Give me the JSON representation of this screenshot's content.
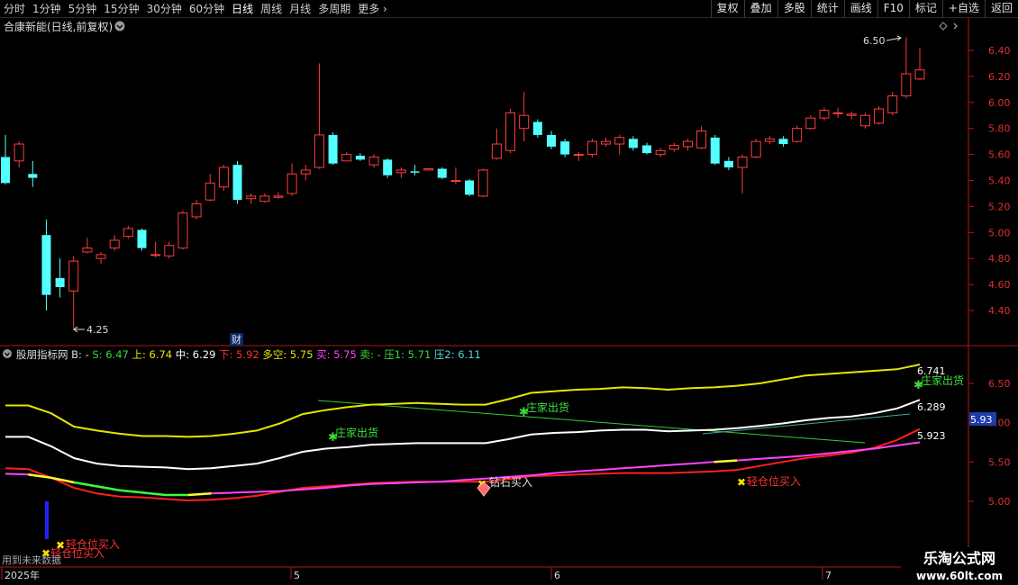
{
  "toolbar": {
    "periods": [
      "分时",
      "1分钟",
      "5分钟",
      "15分钟",
      "30分钟",
      "60分钟",
      "日线",
      "周线",
      "月线",
      "多周期",
      "更多"
    ],
    "active_period": "日线",
    "actions": [
      "复权",
      "叠加",
      "多股",
      "统计",
      "画线",
      "F10",
      "标记",
      "+自选",
      "返回"
    ]
  },
  "main_chart": {
    "title": "合康新能(日线,前复权)",
    "price_ticks": [
      "6.40",
      "6.20",
      "6.00",
      "5.80",
      "5.60",
      "5.40",
      "5.20",
      "5.00",
      "4.80",
      "4.60",
      "4.40"
    ],
    "high_label": "6.50",
    "low_label": "4.25",
    "event_marker": "财"
  },
  "indicator": {
    "name": "股朋指标网",
    "readouts": [
      {
        "label": "B:",
        "value": "-",
        "color": "#dcdcdc"
      },
      {
        "label": "S:",
        "value": "6.47",
        "color": "#39d839"
      },
      {
        "label": "上:",
        "value": "6.74",
        "color": "#e6e600"
      },
      {
        "label": "中:",
        "value": "6.29",
        "color": "#ffffff"
      },
      {
        "label": "下:",
        "value": "5.92",
        "color": "#ff3030"
      },
      {
        "label": "多空:",
        "value": "5.75",
        "color": "#e6e600"
      },
      {
        "label": "买:",
        "value": "5.75",
        "color": "#ff44ff"
      },
      {
        "label": "卖:",
        "value": "-",
        "color": "#39d839"
      },
      {
        "label": "压1:",
        "value": "5.71",
        "color": "#39d839"
      },
      {
        "label": "压2:",
        "value": "6.11",
        "color": "#4fd6d6"
      }
    ],
    "ticks": [
      "6.50",
      "6.00",
      "5.50",
      "5.00"
    ],
    "end_labels": [
      "6.741",
      "6.289",
      "5.923"
    ],
    "current_price": "5.93",
    "signals": {
      "sell": "庄家出货",
      "diamond_buy": "钻石买入",
      "light_buy": "轻仓位买入"
    },
    "future_note": "用到未来数据"
  },
  "time_axis": {
    "labels": [
      "2025年",
      "5",
      "6",
      "7"
    ]
  },
  "watermark": {
    "title": "乐淘公式网",
    "url": "www.60lt.com"
  },
  "chart_data": {
    "type": "candlestick",
    "price_ylim": [
      4.25,
      6.5
    ],
    "candles": [
      {
        "o": 5.58,
        "c": 5.38,
        "h": 5.75,
        "l": 5.37
      },
      {
        "o": 5.55,
        "c": 5.68,
        "h": 5.7,
        "l": 5.5
      },
      {
        "o": 5.45,
        "c": 5.42,
        "h": 5.55,
        "l": 5.35
      },
      {
        "o": 4.98,
        "c": 4.52,
        "h": 5.1,
        "l": 4.4
      },
      {
        "o": 4.65,
        "c": 4.58,
        "h": 4.8,
        "l": 4.5
      },
      {
        "o": 4.55,
        "c": 4.78,
        "h": 4.82,
        "l": 4.25
      },
      {
        "o": 4.85,
        "c": 4.88,
        "h": 4.96,
        "l": 4.84
      },
      {
        "o": 4.8,
        "c": 4.83,
        "h": 4.85,
        "l": 4.76
      },
      {
        "o": 4.88,
        "c": 4.94,
        "h": 4.98,
        "l": 4.86
      },
      {
        "o": 4.97,
        "c": 5.03,
        "h": 5.05,
        "l": 4.95
      },
      {
        "o": 5.02,
        "c": 4.88,
        "h": 5.03,
        "l": 4.86
      },
      {
        "o": 4.83,
        "c": 4.83,
        "h": 4.93,
        "l": 4.81
      },
      {
        "o": 4.82,
        "c": 4.9,
        "h": 4.93,
        "l": 4.8
      },
      {
        "o": 4.88,
        "c": 5.15,
        "h": 5.17,
        "l": 4.87
      },
      {
        "o": 5.12,
        "c": 5.22,
        "h": 5.25,
        "l": 5.1
      },
      {
        "o": 5.25,
        "c": 5.38,
        "h": 5.45,
        "l": 5.24
      },
      {
        "o": 5.35,
        "c": 5.5,
        "h": 5.52,
        "l": 5.32
      },
      {
        "o": 5.52,
        "c": 5.25,
        "h": 5.55,
        "l": 5.22
      },
      {
        "o": 5.26,
        "c": 5.28,
        "h": 5.3,
        "l": 5.22
      },
      {
        "o": 5.24,
        "c": 5.28,
        "h": 5.3,
        "l": 5.23
      },
      {
        "o": 5.27,
        "c": 5.28,
        "h": 5.31,
        "l": 5.26
      },
      {
        "o": 5.3,
        "c": 5.45,
        "h": 5.53,
        "l": 5.28
      },
      {
        "o": 5.45,
        "c": 5.48,
        "h": 5.52,
        "l": 5.4
      },
      {
        "o": 5.5,
        "c": 5.75,
        "h": 6.3,
        "l": 5.49
      },
      {
        "o": 5.75,
        "c": 5.53,
        "h": 5.77,
        "l": 5.52
      },
      {
        "o": 5.55,
        "c": 5.6,
        "h": 5.62,
        "l": 5.55
      },
      {
        "o": 5.59,
        "c": 5.56,
        "h": 5.61,
        "l": 5.55
      },
      {
        "o": 5.52,
        "c": 5.58,
        "h": 5.6,
        "l": 5.5
      },
      {
        "o": 5.56,
        "c": 5.44,
        "h": 5.57,
        "l": 5.42
      },
      {
        "o": 5.46,
        "c": 5.48,
        "h": 5.5,
        "l": 5.42
      },
      {
        "o": 5.47,
        "c": 5.46,
        "h": 5.52,
        "l": 5.44
      },
      {
        "o": 5.48,
        "c": 5.49,
        "h": 5.49,
        "l": 5.48
      },
      {
        "o": 5.49,
        "c": 5.42,
        "h": 5.5,
        "l": 5.41
      },
      {
        "o": 5.4,
        "c": 5.4,
        "h": 5.5,
        "l": 5.37
      },
      {
        "o": 5.4,
        "c": 5.29,
        "h": 5.41,
        "l": 5.28
      },
      {
        "o": 5.28,
        "c": 5.48,
        "h": 5.49,
        "l": 5.27
      },
      {
        "o": 5.57,
        "c": 5.68,
        "h": 5.8,
        "l": 5.56
      },
      {
        "o": 5.63,
        "c": 5.92,
        "h": 5.95,
        "l": 5.61
      },
      {
        "o": 5.8,
        "c": 5.9,
        "h": 6.08,
        "l": 5.7
      },
      {
        "o": 5.85,
        "c": 5.75,
        "h": 5.87,
        "l": 5.73
      },
      {
        "o": 5.75,
        "c": 5.66,
        "h": 5.78,
        "l": 5.64
      },
      {
        "o": 5.7,
        "c": 5.6,
        "h": 5.72,
        "l": 5.58
      },
      {
        "o": 5.6,
        "c": 5.6,
        "h": 5.62,
        "l": 5.55
      },
      {
        "o": 5.6,
        "c": 5.7,
        "h": 5.72,
        "l": 5.58
      },
      {
        "o": 5.68,
        "c": 5.7,
        "h": 5.73,
        "l": 5.66
      },
      {
        "o": 5.68,
        "c": 5.73,
        "h": 5.75,
        "l": 5.6
      },
      {
        "o": 5.72,
        "c": 5.65,
        "h": 5.74,
        "l": 5.63
      },
      {
        "o": 5.67,
        "c": 5.61,
        "h": 5.69,
        "l": 5.6
      },
      {
        "o": 5.6,
        "c": 5.63,
        "h": 5.65,
        "l": 5.58
      },
      {
        "o": 5.64,
        "c": 5.67,
        "h": 5.69,
        "l": 5.62
      },
      {
        "o": 5.66,
        "c": 5.7,
        "h": 5.72,
        "l": 5.63
      },
      {
        "o": 5.65,
        "c": 5.78,
        "h": 5.82,
        "l": 5.64
      },
      {
        "o": 5.73,
        "c": 5.53,
        "h": 5.75,
        "l": 5.52
      },
      {
        "o": 5.55,
        "c": 5.5,
        "h": 5.58,
        "l": 5.48
      },
      {
        "o": 5.5,
        "c": 5.58,
        "h": 5.6,
        "l": 5.3
      },
      {
        "o": 5.58,
        "c": 5.7,
        "h": 5.72,
        "l": 5.57
      },
      {
        "o": 5.7,
        "c": 5.72,
        "h": 5.74,
        "l": 5.68
      },
      {
        "o": 5.72,
        "c": 5.68,
        "h": 5.74,
        "l": 5.66
      },
      {
        "o": 5.7,
        "c": 5.8,
        "h": 5.82,
        "l": 5.69
      },
      {
        "o": 5.8,
        "c": 5.88,
        "h": 5.9,
        "l": 5.79
      },
      {
        "o": 5.88,
        "c": 5.94,
        "h": 5.96,
        "l": 5.86
      },
      {
        "o": 5.92,
        "c": 5.92,
        "h": 5.96,
        "l": 5.88
      },
      {
        "o": 5.9,
        "c": 5.91,
        "h": 5.93,
        "l": 5.87
      },
      {
        "o": 5.82,
        "c": 5.9,
        "h": 5.92,
        "l": 5.8
      },
      {
        "o": 5.84,
        "c": 5.95,
        "h": 5.97,
        "l": 5.83
      },
      {
        "o": 5.92,
        "c": 6.05,
        "h": 6.08,
        "l": 5.9
      },
      {
        "o": 6.05,
        "c": 6.22,
        "h": 6.5,
        "l": 6.03
      },
      {
        "o": 6.18,
        "c": 6.25,
        "h": 6.42,
        "l": 6.17
      }
    ],
    "indicator_ylim": [
      4.6,
      6.75
    ],
    "indicator_series": [
      {
        "name": "上",
        "color": "#e6e600",
        "values": [
          6.22,
          6.22,
          6.12,
          5.95,
          5.9,
          5.86,
          5.83,
          5.83,
          5.82,
          5.83,
          5.86,
          5.9,
          5.99,
          6.11,
          6.16,
          6.2,
          6.23,
          6.24,
          6.25,
          6.24,
          6.23,
          6.23,
          6.3,
          6.38,
          6.4,
          6.42,
          6.43,
          6.45,
          6.44,
          6.42,
          6.44,
          6.45,
          6.47,
          6.5,
          6.55,
          6.6,
          6.62,
          6.64,
          6.66,
          6.68,
          6.74
        ]
      },
      {
        "name": "中",
        "color": "#ffffff",
        "values": [
          5.82,
          5.82,
          5.7,
          5.55,
          5.48,
          5.45,
          5.44,
          5.43,
          5.41,
          5.42,
          5.45,
          5.48,
          5.55,
          5.63,
          5.67,
          5.69,
          5.72,
          5.73,
          5.74,
          5.74,
          5.74,
          5.74,
          5.79,
          5.85,
          5.87,
          5.88,
          5.9,
          5.91,
          5.91,
          5.89,
          5.9,
          5.91,
          5.93,
          5.96,
          5.99,
          6.03,
          6.06,
          6.08,
          6.12,
          6.18,
          6.29
        ]
      },
      {
        "name": "下",
        "color": "#ff2020",
        "values": [
          5.42,
          5.41,
          5.3,
          5.17,
          5.1,
          5.06,
          5.05,
          5.03,
          5.01,
          5.02,
          5.04,
          5.07,
          5.12,
          5.17,
          5.19,
          5.21,
          5.23,
          5.24,
          5.25,
          5.25,
          5.25,
          5.25,
          5.28,
          5.32,
          5.33,
          5.34,
          5.35,
          5.36,
          5.36,
          5.36,
          5.37,
          5.38,
          5.4,
          5.45,
          5.5,
          5.55,
          5.58,
          5.62,
          5.68,
          5.78,
          5.92
        ]
      },
      {
        "name": "买",
        "color": "#ff44ff",
        "values": [
          5.35,
          5.34,
          5.3,
          5.24,
          5.19,
          5.14,
          5.11,
          5.08,
          5.08,
          5.1,
          5.11,
          5.12,
          5.13,
          5.15,
          5.17,
          5.2,
          5.22,
          5.23,
          5.24,
          5.25,
          5.27,
          5.29,
          5.31,
          5.33,
          5.36,
          5.38,
          5.4,
          5.42,
          5.44,
          5.46,
          5.48,
          5.5,
          5.52,
          5.54,
          5.56,
          5.58,
          5.61,
          5.64,
          5.67,
          5.71,
          5.75
        ]
      }
    ]
  }
}
